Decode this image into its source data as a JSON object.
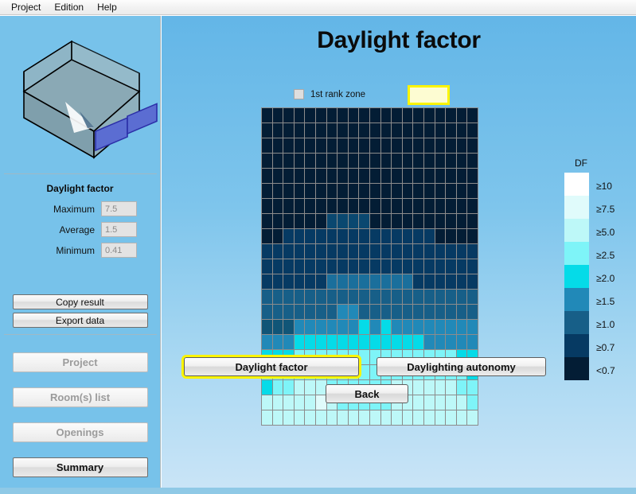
{
  "menu": {
    "items": [
      {
        "label": "Project",
        "name": "menu-project"
      },
      {
        "label": "Edition",
        "name": "menu-edition"
      },
      {
        "label": "Help",
        "name": "menu-help"
      }
    ]
  },
  "sidebar": {
    "preview_name": "room-3d-preview",
    "results": {
      "title": "Daylight factor",
      "fields": [
        {
          "label": "Maximum",
          "value": "7.5"
        },
        {
          "label": "Average",
          "value": "1.5"
        },
        {
          "label": "Minimum",
          "value": "0.41"
        }
      ]
    },
    "actions": [
      {
        "label": "Copy result",
        "enabled": true
      },
      {
        "label": "Export data",
        "enabled": true
      }
    ],
    "navigation": [
      {
        "label": "Project",
        "enabled": false
      },
      {
        "label": "Room(s) list",
        "enabled": false
      },
      {
        "label": "Openings",
        "enabled": false
      },
      {
        "label": "Summary",
        "enabled": true
      }
    ]
  },
  "main": {
    "title": "Daylight factor",
    "rank_zone": {
      "label": "1st rank zone",
      "checked": false,
      "swatch_fill": "#fdfcd2",
      "swatch_border": "#fbf400"
    },
    "buttons": [
      {
        "label": "Daylight factor",
        "name": "btn-daylight-factor",
        "selected": true
      },
      {
        "label": "Daylighting autonomy",
        "name": "btn-daylighting-autonomy",
        "selected": false
      },
      {
        "label": "Back",
        "name": "btn-back",
        "selected": false
      }
    ]
  },
  "legend": {
    "title": "DF",
    "entries": [
      {
        "label": "≥10",
        "color": "#ffffff"
      },
      {
        "label": "≥7.5",
        "color": "#e0fbfb"
      },
      {
        "label": "≥5.0",
        "color": "#bdf8f8"
      },
      {
        "label": "≥2.5",
        "color": "#7ef4f8"
      },
      {
        "label": "≥2.0",
        "color": "#05dbe8"
      },
      {
        "label": "≥1.5",
        "color": "#2189b8"
      },
      {
        "label": "≥1.0",
        "color": "#175f88"
      },
      {
        "label": "≥0.7",
        "color": "#063a63"
      },
      {
        "label": "<0.7",
        "color": "#031d35"
      }
    ]
  },
  "chart_data": {
    "type": "heatmap",
    "title": "Daylight factor",
    "unit": "DF",
    "rows": 21,
    "cols": 20,
    "colorbar_levels": [
      10,
      7.5,
      5.0,
      2.5,
      2.0,
      1.5,
      1.0,
      0.7
    ],
    "colorbar_colors": [
      "#ffffff",
      "#e0fbfb",
      "#bdf8f8",
      "#7ef4f8",
      "#05dbe8",
      "#2189b8",
      "#175f88",
      "#063a63",
      "#031d35"
    ],
    "statistics": {
      "maximum": 7.5,
      "average": 1.5,
      "minimum": 0.41
    },
    "grid": [
      [
        "#031d35",
        "#031d35",
        "#031d35",
        "#031d35",
        "#031d35",
        "#031d35",
        "#031d35",
        "#031d35",
        "#031d35",
        "#031d35",
        "#031d35",
        "#031d35",
        "#031d35",
        "#031d35",
        "#031d35",
        "#031d35",
        "#031d35",
        "#031d35",
        "#031d35",
        "#031d35"
      ],
      [
        "#031d35",
        "#031d35",
        "#031d35",
        "#031d35",
        "#031d35",
        "#031d35",
        "#031d35",
        "#031d35",
        "#031d35",
        "#031d35",
        "#031d35",
        "#031d35",
        "#031d35",
        "#031d35",
        "#031d35",
        "#031d35",
        "#031d35",
        "#031d35",
        "#031d35",
        "#031d35"
      ],
      [
        "#031d35",
        "#031d35",
        "#031d35",
        "#031d35",
        "#031d35",
        "#031d35",
        "#031d35",
        "#031d35",
        "#031d35",
        "#031d35",
        "#031d35",
        "#031d35",
        "#031d35",
        "#031d35",
        "#031d35",
        "#031d35",
        "#031d35",
        "#031d35",
        "#031d35",
        "#031d35"
      ],
      [
        "#031d35",
        "#031d35",
        "#031d35",
        "#031d35",
        "#031d35",
        "#031d35",
        "#031d35",
        "#031d35",
        "#031d35",
        "#031d35",
        "#031d35",
        "#031d35",
        "#031d35",
        "#031d35",
        "#031d35",
        "#031d35",
        "#031d35",
        "#031d35",
        "#031d35",
        "#031d35"
      ],
      [
        "#031d35",
        "#031d35",
        "#031d35",
        "#031d35",
        "#031d35",
        "#031d35",
        "#031d35",
        "#031d35",
        "#031d35",
        "#031d35",
        "#031d35",
        "#031d35",
        "#031d35",
        "#031d35",
        "#031d35",
        "#031d35",
        "#031d35",
        "#031d35",
        "#031d35",
        "#031d35"
      ],
      [
        "#031d35",
        "#031d35",
        "#031d35",
        "#031d35",
        "#031d35",
        "#031d35",
        "#031d35",
        "#031d35",
        "#031d35",
        "#031d35",
        "#031d35",
        "#031d35",
        "#031d35",
        "#031d35",
        "#031d35",
        "#031d35",
        "#031d35",
        "#031d35",
        "#031d35",
        "#031d35"
      ],
      [
        "#031d35",
        "#031d35",
        "#031d35",
        "#031d35",
        "#031d35",
        "#031d35",
        "#031d35",
        "#031d35",
        "#031d35",
        "#031d35",
        "#031d35",
        "#031d35",
        "#031d35",
        "#031d35",
        "#031d35",
        "#031d35",
        "#031d35",
        "#031d35",
        "#031d35",
        "#031d35"
      ],
      [
        "#031d35",
        "#031d35",
        "#031d35",
        "#031d35",
        "#031d35",
        "#031d35",
        "#0a4870",
        "#0a4870",
        "#0a4870",
        "#0a4870",
        "#031d35",
        "#031d35",
        "#031d35",
        "#031d35",
        "#031d35",
        "#031d35",
        "#031d35",
        "#031d35",
        "#031d35",
        "#031d35"
      ],
      [
        "#031d35",
        "#031d35",
        "#063a63",
        "#063a63",
        "#063a63",
        "#063a63",
        "#063a63",
        "#063a63",
        "#063a63",
        "#063a63",
        "#063a63",
        "#063a63",
        "#063a63",
        "#063a63",
        "#063a63",
        "#063a63",
        "#031d35",
        "#031d35",
        "#031d35",
        "#031d35"
      ],
      [
        "#063a63",
        "#063a63",
        "#063a63",
        "#063a63",
        "#063a63",
        "#063a63",
        "#063a63",
        "#063a63",
        "#063a63",
        "#063a63",
        "#063a63",
        "#063a63",
        "#063a63",
        "#063a63",
        "#063a63",
        "#063a63",
        "#063a63",
        "#063a63",
        "#063a63",
        "#063a63"
      ],
      [
        "#063a63",
        "#063a63",
        "#063a63",
        "#063a63",
        "#063a63",
        "#063a63",
        "#063a63",
        "#063a63",
        "#063a63",
        "#063a63",
        "#063a63",
        "#063a63",
        "#063a63",
        "#063a63",
        "#063a63",
        "#063a63",
        "#063a63",
        "#063a63",
        "#063a63",
        "#063a63"
      ],
      [
        "#063a63",
        "#063a63",
        "#063a63",
        "#063a63",
        "#063a63",
        "#063a63",
        "#1a6f9c",
        "#1a6f9c",
        "#1a6f9c",
        "#1a6f9c",
        "#1a6f9c",
        "#1a6f9c",
        "#1a6f9c",
        "#1a6f9c",
        "#063a63",
        "#063a63",
        "#063a63",
        "#063a63",
        "#063a63",
        "#063a63"
      ],
      [
        "#175f88",
        "#175f88",
        "#175f88",
        "#175f88",
        "#175f88",
        "#175f88",
        "#175f88",
        "#175f88",
        "#175f88",
        "#175f88",
        "#175f88",
        "#175f88",
        "#175f88",
        "#175f88",
        "#175f88",
        "#175f88",
        "#175f88",
        "#175f88",
        "#175f88",
        "#175f88"
      ],
      [
        "#175f88",
        "#175f88",
        "#175f88",
        "#175f88",
        "#175f88",
        "#175f88",
        "#175f88",
        "#2189b8",
        "#2189b8",
        "#175f88",
        "#175f88",
        "#175f88",
        "#175f88",
        "#175f88",
        "#175f88",
        "#175f88",
        "#175f88",
        "#175f88",
        "#175f88",
        "#175f88"
      ],
      [
        "#105577",
        "#105577",
        "#105577",
        "#2189b8",
        "#2189b8",
        "#2189b8",
        "#2189b8",
        "#2189b8",
        "#2189b8",
        "#05dbe8",
        "#2189b8",
        "#05dbe8",
        "#2189b8",
        "#2189b8",
        "#2189b8",
        "#2189b8",
        "#2189b8",
        "#2189b8",
        "#2189b8",
        "#2189b8"
      ],
      [
        "#2189b8",
        "#2189b8",
        "#2189b8",
        "#05dbe8",
        "#05dbe8",
        "#05dbe8",
        "#05dbe8",
        "#05dbe8",
        "#05dbe8",
        "#05dbe8",
        "#05dbe8",
        "#05dbe8",
        "#05dbe8",
        "#05dbe8",
        "#05dbe8",
        "#2189b8",
        "#2189b8",
        "#2189b8",
        "#2189b8",
        "#2189b8"
      ],
      [
        "#05dbe8",
        "#05dbe8",
        "#05dbe8",
        "#7ef4f8",
        "#7ef4f8",
        "#7ef4f8",
        "#7ef4f8",
        "#7ef4f8",
        "#7ef4f8",
        "#7ef4f8",
        "#7ef4f8",
        "#7ef4f8",
        "#7ef4f8",
        "#7ef4f8",
        "#7ef4f8",
        "#7ef4f8",
        "#7ef4f8",
        "#7ef4f8",
        "#05dbe8",
        "#05dbe8"
      ],
      [
        "#7ef4f8",
        "#7ef4f8",
        "#7ef4f8",
        "#7ef4f8",
        "#7ef4f8",
        "#7ef4f8",
        "#7ef4f8",
        "#7ef4f8",
        "#7ef4f8",
        "#7ef4f8",
        "#7ef4f8",
        "#7ef4f8",
        "#7ef4f8",
        "#7ef4f8",
        "#7ef4f8",
        "#7ef4f8",
        "#7ef4f8",
        "#7ef4f8",
        "#7ef4f8",
        "#05dbe8"
      ],
      [
        "#05dbe8",
        "#7ef4f8",
        "#7ef4f8",
        "#bdf8f8",
        "#bdf8f8",
        "#bdf8f8",
        "#7ef4f8",
        "#7ef4f8",
        "#7ef4f8",
        "#7ef4f8",
        "#7ef4f8",
        "#7ef4f8",
        "#bdf8f8",
        "#bdf8f8",
        "#bdf8f8",
        "#bdf8f8",
        "#bdf8f8",
        "#bdf8f8",
        "#7ef4f8",
        "#7ef4f8"
      ],
      [
        "#bdf8f8",
        "#bdf8f8",
        "#bdf8f8",
        "#bdf8f8",
        "#bdf8f8",
        "#e0fbfb",
        "#bdf8f8",
        "#7ef4f8",
        "#7ef4f8",
        "#7ef4f8",
        "#7ef4f8",
        "#7ef4f8",
        "#bdf8f8",
        "#bdf8f8",
        "#bdf8f8",
        "#bdf8f8",
        "#bdf8f8",
        "#bdf8f8",
        "#bdf8f8",
        "#7ef4f8"
      ],
      [
        "#bdf8f8",
        "#bdf8f8",
        "#bdf8f8",
        "#bdf8f8",
        "#bdf8f8",
        "#bdf8f8",
        "#bdf8f8",
        "#bdf8f8",
        "#bdf8f8",
        "#bdf8f8",
        "#bdf8f8",
        "#bdf8f8",
        "#bdf8f8",
        "#bdf8f8",
        "#bdf8f8",
        "#bdf8f8",
        "#bdf8f8",
        "#bdf8f8",
        "#bdf8f8",
        "#bdf8f8"
      ]
    ]
  }
}
